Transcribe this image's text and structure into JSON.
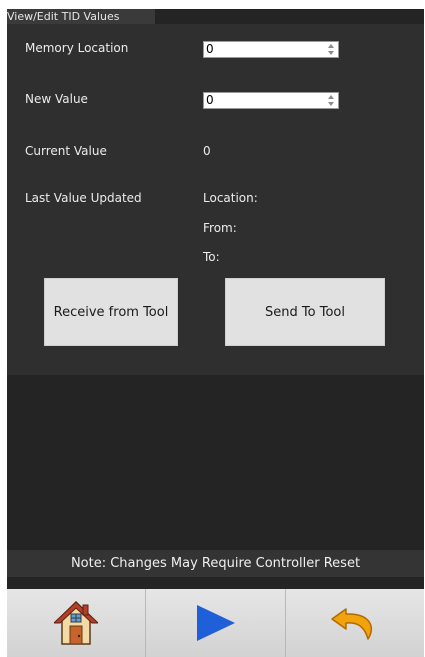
{
  "window": {
    "title": "View/Edit TID Values"
  },
  "fields": {
    "memory_location": {
      "label": "Memory Location",
      "value": "0"
    },
    "new_value": {
      "label": "New Value",
      "value": "0"
    },
    "current_value": {
      "label": "Current Value",
      "value": "0"
    },
    "last_value_updated": {
      "label": "Last Value Updated",
      "location_label": "Location:",
      "from_label": "From:",
      "to_label": "To:"
    }
  },
  "buttons": {
    "receive": "Receive from Tool",
    "send": "Send To Tool"
  },
  "note": "Note: Changes May Require Controller Reset",
  "nav": {
    "home_icon": "home-icon",
    "play_icon": "play-icon",
    "back_icon": "undo-icon"
  },
  "colors": {
    "background": "#242424",
    "panel": "#2f2f2f",
    "button": "#e1e1e1",
    "play": "#1f5fd8",
    "undo": "#f2a20a"
  }
}
